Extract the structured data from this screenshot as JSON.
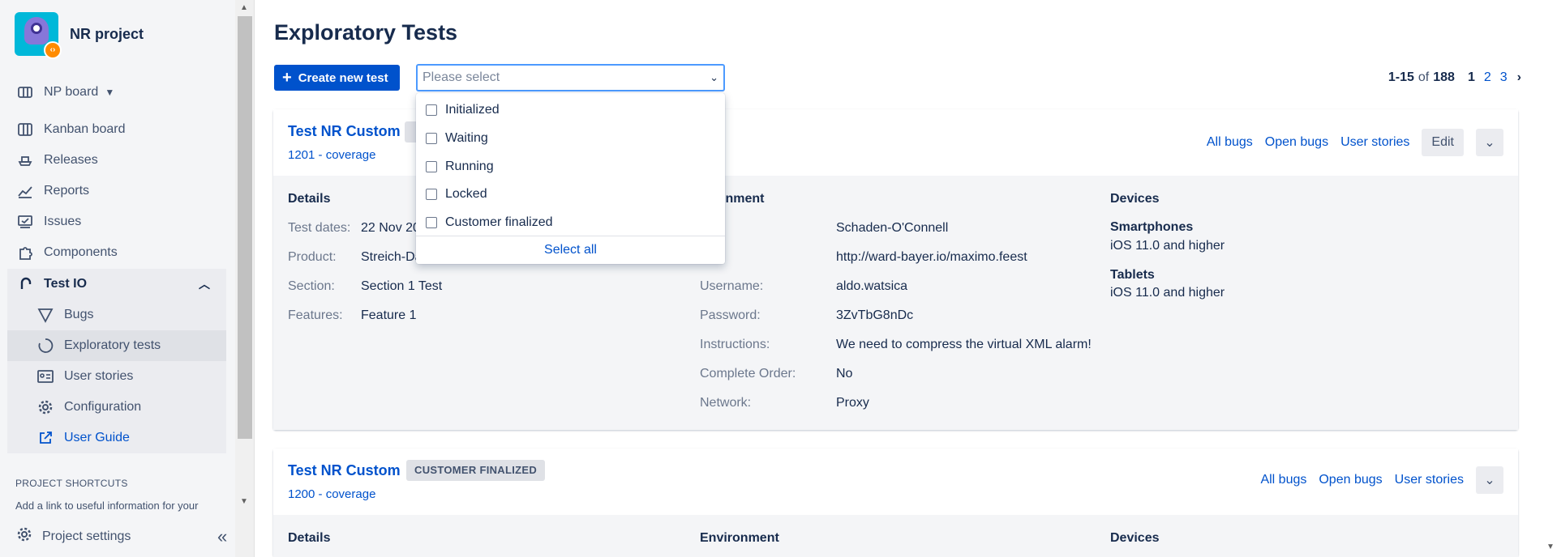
{
  "project": {
    "name": "NR project"
  },
  "sidebar": {
    "board": "NP board",
    "items": [
      {
        "label": "Kanban board",
        "icon": "kanban-icon"
      },
      {
        "label": "Releases",
        "icon": "ship-icon"
      },
      {
        "label": "Reports",
        "icon": "chart-icon"
      },
      {
        "label": "Issues",
        "icon": "issues-icon"
      },
      {
        "label": "Components",
        "icon": "puzzle-icon"
      }
    ],
    "group": "Test IO",
    "sub_items": [
      {
        "label": "Bugs",
        "icon": "triangle-icon"
      },
      {
        "label": "Exploratory tests",
        "icon": "circle-icon"
      },
      {
        "label": "User stories",
        "icon": "id-card-icon"
      },
      {
        "label": "Configuration",
        "icon": "gear-icon"
      },
      {
        "label": "User Guide",
        "icon": "external-link-icon"
      }
    ],
    "shortcuts_title": "PROJECT SHORTCUTS",
    "shortcuts_text": "Add a link to useful information for your",
    "settings": "Project settings"
  },
  "page": {
    "title": "Exploratory Tests",
    "create_button": "Create new test",
    "select_placeholder": "Please select",
    "filter_options": [
      "Initialized",
      "Waiting",
      "Running",
      "Locked",
      "Customer finalized"
    ],
    "select_all": "Select all",
    "pager": {
      "range": "1-15",
      "of": "of",
      "total": "188",
      "pages": [
        "1",
        "2",
        "3"
      ]
    }
  },
  "cards": [
    {
      "title": "Test NR Custom",
      "subtitle": "1201 - coverage",
      "actions": [
        "All bugs",
        "Open bugs",
        "User stories"
      ],
      "edit": "Edit",
      "details_title": "Details",
      "details": [
        {
          "label": "Test dates:",
          "value": "22 Nov 20"
        },
        {
          "label": "Product:",
          "value": "Streich-Da"
        },
        {
          "label": "Section:",
          "value": "Section 1 Test"
        },
        {
          "label": "Features:",
          "value": "Feature 1"
        }
      ],
      "env_title": "ironment",
      "env": [
        {
          "label": "",
          "value": "Schaden-O'Connell"
        },
        {
          "label": "",
          "value": "http://ward-bayer.io/maximo.feest"
        },
        {
          "label": "Username:",
          "value": "aldo.watsica"
        },
        {
          "label": "Password:",
          "value": "3ZvTbG8nDc"
        },
        {
          "label": "Instructions:",
          "value": "We need to compress the virtual XML alarm!"
        },
        {
          "label": "Complete Order:",
          "value": "No"
        },
        {
          "label": "Network:",
          "value": "Proxy"
        }
      ],
      "devices_title": "Devices",
      "devices": [
        {
          "type": "Smartphones",
          "os": "iOS 11.0 and higher"
        },
        {
          "type": "Tablets",
          "os": "iOS 11.0 and higher"
        }
      ]
    },
    {
      "title": "Test NR Custom",
      "status": "CUSTOMER FINALIZED",
      "subtitle": "1200 - coverage",
      "actions": [
        "All bugs",
        "Open bugs",
        "User stories"
      ],
      "details_title": "Details",
      "env_title": "Environment",
      "devices_title": "Devices"
    }
  ]
}
